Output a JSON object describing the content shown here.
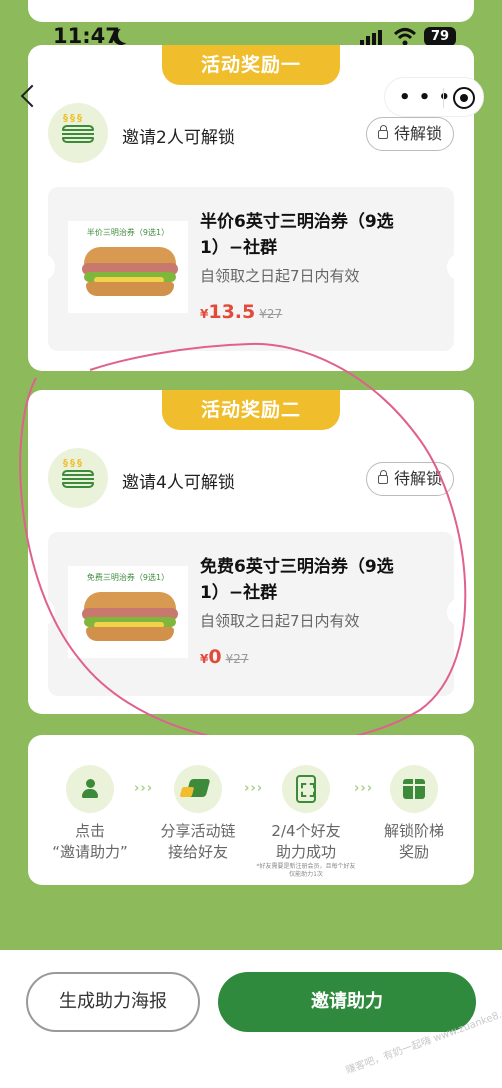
{
  "status_bar": {
    "time": "11:47",
    "battery": "79"
  },
  "nav": {
    "back_icon": "chevron-left-icon",
    "more_icon": "more-dots-icon",
    "close_icon": "target-icon"
  },
  "rewards": [
    {
      "banner": "活动奖励一",
      "unlock_text": "邀请2人可解锁",
      "lock_label": "待解锁",
      "coupon": {
        "image_label": "半价三明治券（9选1）",
        "title": "半价6英寸三明治券（9选1）−社群",
        "validity": "自领取之日起7日内有效",
        "currency": "¥",
        "price": "13.5",
        "original_price": "¥27"
      }
    },
    {
      "banner": "活动奖励二",
      "unlock_text": "邀请4人可解锁",
      "lock_label": "待解锁",
      "coupon": {
        "image_label": "免费三明治券（9选1）",
        "title": "免费6英寸三明治券（9选1）−社群",
        "validity": "自领取之日起7日内有效",
        "currency": "¥",
        "price": "0",
        "original_price": "¥27"
      }
    }
  ],
  "steps": [
    {
      "label": "点击\n“邀请助力”",
      "icon": "people-icon"
    },
    {
      "label": "分享活动链\n接给好友",
      "icon": "share-icon"
    },
    {
      "label": "2/4个好友\n助力成功",
      "icon": "phone-scan-icon",
      "note": "*好友需要是新注册会员，且每个好友仅能助力1次"
    },
    {
      "label": "解锁阶梯\n奖励",
      "icon": "gift-icon"
    }
  ],
  "step_arrows": "›››",
  "bottom": {
    "poster_button": "生成助力海报",
    "invite_button": "邀请助力",
    "watermark": "赚客吧，有奶一起嗨 www.zuanke8.com"
  },
  "colors": {
    "background": "#8dbb5b",
    "banner": "#f0bd2c",
    "primary": "#2f8a3e",
    "price": "#e24a3b",
    "annotation": "#e0608f"
  }
}
